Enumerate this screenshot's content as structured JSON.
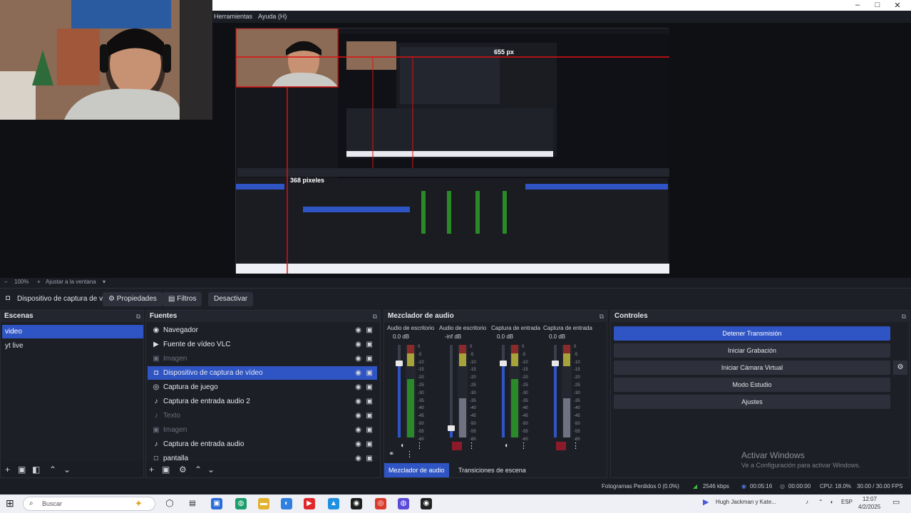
{
  "window": {
    "menu": [
      "Herramientas",
      "Ayuda (H)"
    ],
    "controls": [
      "–",
      "□",
      "✕"
    ]
  },
  "preview": {
    "zoom_label": "100%",
    "fit_label": "Ajustar a la ventana",
    "nested_measure_1": "655 px",
    "nested_measure_2": "368 pixeles"
  },
  "source_toolbar": {
    "device": "Dispositivo de captura de v",
    "properties": "Propiedades",
    "filters": "Filtros",
    "deactivate": "Desactivar"
  },
  "scenes": {
    "title": "Escenas",
    "items": [
      {
        "label": "video",
        "selected": true
      },
      {
        "label": "yt live",
        "selected": false
      }
    ]
  },
  "sources": {
    "title": "Fuentes",
    "items": [
      {
        "label": "Navegador",
        "icon": "globe-icon",
        "glyph": "◉",
        "dim": false,
        "selected": false
      },
      {
        "label": "Fuente de vídeo VLC",
        "icon": "play-icon",
        "glyph": "▶",
        "dim": false,
        "selected": false
      },
      {
        "label": "Imagen",
        "icon": "image-icon",
        "glyph": "▣",
        "dim": true,
        "selected": false
      },
      {
        "label": "Dispositivo de captura de vídeo",
        "icon": "camera-icon",
        "glyph": "◘",
        "dim": false,
        "selected": true
      },
      {
        "label": "Captura de juego",
        "icon": "gamepad-icon",
        "glyph": "◎",
        "dim": false,
        "selected": false
      },
      {
        "label": "Captura de entrada audio 2",
        "icon": "mic-icon",
        "glyph": "♪",
        "dim": false,
        "selected": false
      },
      {
        "label": "Texto",
        "icon": "mic-icon",
        "glyph": "♪",
        "dim": true,
        "selected": false
      },
      {
        "label": "Imagen",
        "icon": "image-icon",
        "glyph": "▣",
        "dim": true,
        "selected": false
      },
      {
        "label": "Captura de entrada audio",
        "icon": "mic-icon",
        "glyph": "♪",
        "dim": false,
        "selected": false
      },
      {
        "label": "pantalla",
        "icon": "monitor-icon",
        "glyph": "□",
        "dim": false,
        "selected": false
      }
    ]
  },
  "mixer": {
    "title": "Mezclador de audio",
    "channels": [
      {
        "name": "Audio de escritorio",
        "db": "0.0 dB",
        "level": 0.8,
        "muted": false
      },
      {
        "name": "Audio de escritorio",
        "db": "-inf dB",
        "level": 0.1,
        "muted": true
      },
      {
        "name": "Captura de entrada",
        "db": "0.0 dB",
        "level": 0.8,
        "muted": false
      },
      {
        "name": "Captura de entrada",
        "db": "0.0 dB",
        "level": 0.8,
        "muted": true
      }
    ],
    "tabs": [
      "Mezclador de audio",
      "Transiciones de escena"
    ],
    "ticks": [
      "0",
      "-5",
      "-10",
      "-15",
      "-20",
      "-25",
      "-30",
      "-35",
      "-40",
      "-45",
      "-50",
      "-55",
      "-60"
    ]
  },
  "controls": {
    "title": "Controles",
    "buttons": [
      {
        "label": "Detener Transmisión",
        "active": true
      },
      {
        "label": "Iniciar Grabación",
        "active": false
      },
      {
        "label": "Iniciar Cámara Virtual",
        "active": false
      },
      {
        "label": "Modo Estudio",
        "active": false
      },
      {
        "label": "Ajustes",
        "active": false
      }
    ]
  },
  "activate": {
    "title": "Activar Windows",
    "subtitle": "Ve a Configuración para activar Windows."
  },
  "status": {
    "dropped": "Fotogramas Perdidos 0 (0.0%)",
    "bitrate": "2546 kbps",
    "stream_time": "00:05:16",
    "rec_time": "00:00:00",
    "cpu": "CPU: 18.0%",
    "fps": "30.00 / 30.00 FPS"
  },
  "taskbar": {
    "search_placeholder": "Buscar",
    "tray_text": "Hugh Jackman y Kate...",
    "lang": "ESP",
    "time": "12:07",
    "date": "4/2/2025"
  },
  "colors": {
    "accent": "#2f55c4",
    "panel": "#1d1f26",
    "muted_red": "#8b1b2a"
  }
}
